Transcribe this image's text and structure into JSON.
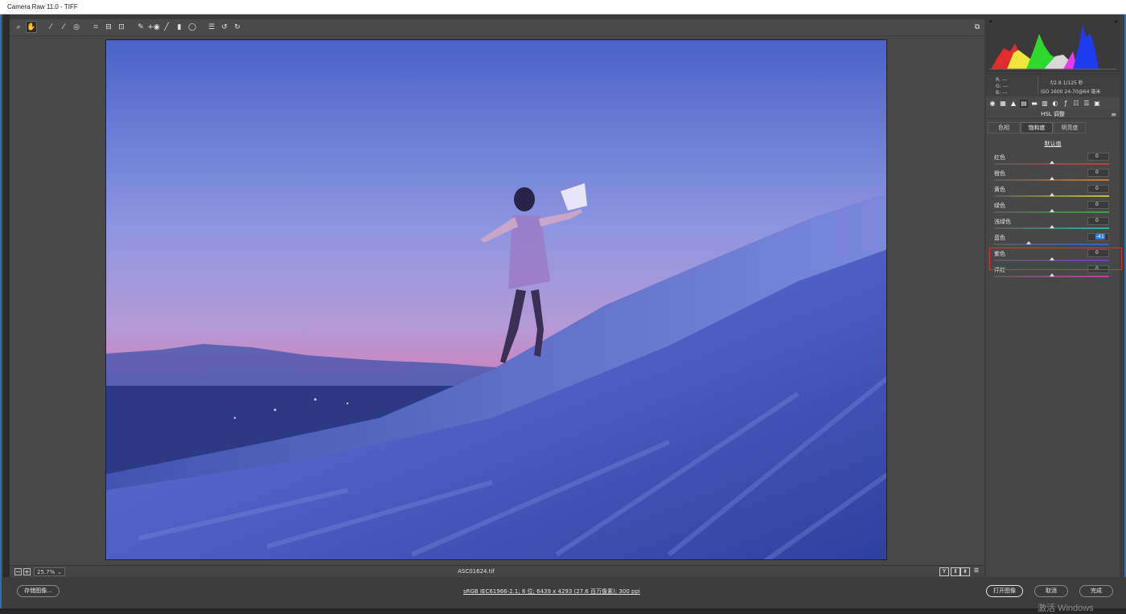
{
  "window": {
    "title": "Camera Raw 11.0 -  TIFF"
  },
  "toolbar": {
    "tools": [
      {
        "name": "zoom-tool",
        "glyph": "⌕"
      },
      {
        "name": "hand-tool",
        "glyph": "✋"
      },
      {
        "name": "white-balance-tool",
        "glyph": "⁄"
      },
      {
        "name": "color-sampler-tool",
        "glyph": "⁄"
      },
      {
        "name": "targeted-adjustment-tool",
        "glyph": "◎"
      },
      {
        "name": "crop-tool",
        "glyph": "⌗"
      },
      {
        "name": "straighten-tool",
        "glyph": "⊟"
      },
      {
        "name": "transform-tool",
        "glyph": "⊡"
      },
      {
        "name": "spot-removal-tool",
        "glyph": "✎"
      },
      {
        "name": "red-eye-tool",
        "glyph": "+◉"
      },
      {
        "name": "adjustment-brush-tool",
        "glyph": "╱"
      },
      {
        "name": "graduated-filter-tool",
        "glyph": "▮"
      },
      {
        "name": "radial-filter-tool",
        "glyph": "◯"
      },
      {
        "name": "preferences-icon",
        "glyph": "☰"
      },
      {
        "name": "rotate-left-icon",
        "glyph": "↺"
      },
      {
        "name": "rotate-right-icon",
        "glyph": "↻"
      }
    ],
    "fullscreen_glyph": "⧉"
  },
  "status": {
    "zoom_value": "25.7%",
    "filename": "ASC01624.tif",
    "before_after": "Y"
  },
  "footer": {
    "save_label": "存储图像...",
    "info_text": "sRGB IEC61966-2.1; 8 位; 6439 x 4293 (27.6 百万像素); 300 ppi",
    "open_label": "打开图像",
    "cancel_label": "取消",
    "done_label": "完成",
    "watermark": "激活 Windows"
  },
  "histogram": {
    "rgb_lines": [
      "R:  ---",
      "G:  ---",
      "B:  ---"
    ],
    "exif_line1": "f/2.8   1/125 秒",
    "exif_line2": "ISO 1600   24-70@64 毫米"
  },
  "panel": {
    "section_title": "HSL 调整",
    "tabs": [
      "色相",
      "饱和度",
      "明亮度"
    ],
    "selected_tab": "饱和度",
    "default_link": "默认值",
    "sliders": [
      {
        "label": "红色",
        "value": "0",
        "pos": 0.5,
        "color": "#c63a3a",
        "edit": false
      },
      {
        "label": "橙色",
        "value": "0",
        "pos": 0.5,
        "color": "#c97a30",
        "edit": false
      },
      {
        "label": "黄色",
        "value": "0",
        "pos": 0.5,
        "color": "#c8bf34",
        "edit": false
      },
      {
        "label": "绿色",
        "value": "0",
        "pos": 0.5,
        "color": "#3aa83a",
        "edit": false
      },
      {
        "label": "浅绿色",
        "value": "0",
        "pos": 0.5,
        "color": "#2fb2a6",
        "edit": false
      },
      {
        "label": "蓝色",
        "value": "-41",
        "pos": 0.3,
        "color": "#3a5ec8",
        "edit": true
      },
      {
        "label": "紫色",
        "value": "0",
        "pos": 0.5,
        "color": "#7a3ac8",
        "edit": false
      },
      {
        "label": "洋红",
        "value": "0",
        "pos": 0.5,
        "color": "#c83ab0",
        "edit": false
      }
    ]
  }
}
